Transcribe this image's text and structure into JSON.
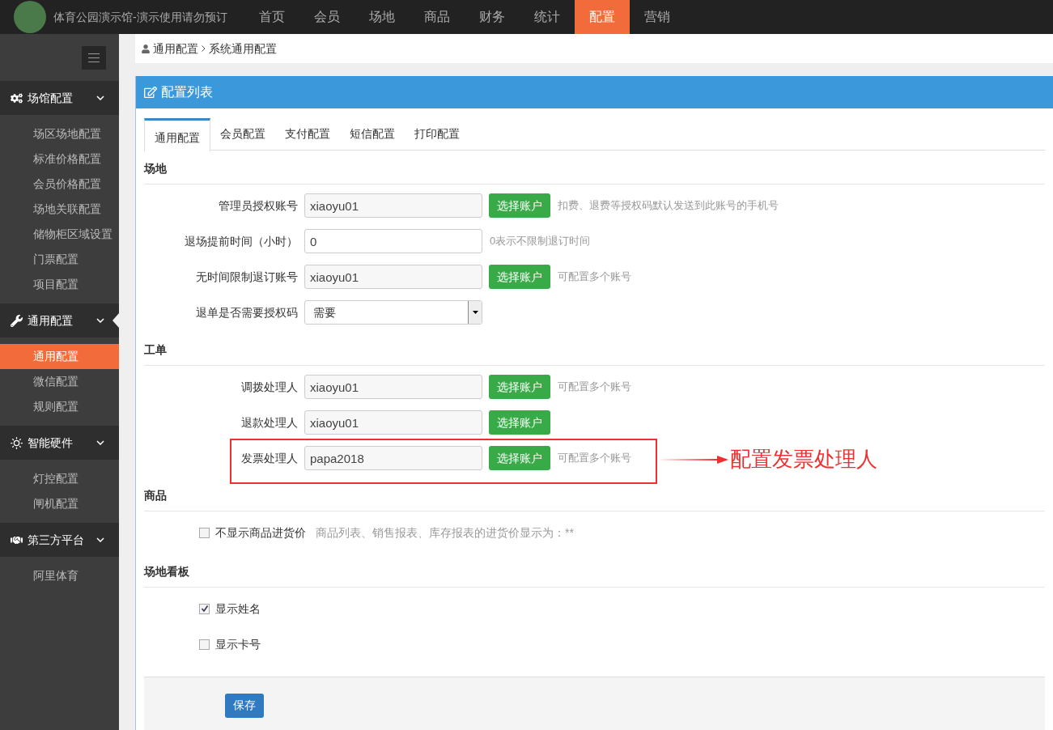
{
  "brand": {
    "title": "体育公园演示馆-演示使用请勿预订"
  },
  "nav": [
    {
      "label": "首页",
      "selected": false
    },
    {
      "label": "会员",
      "selected": false
    },
    {
      "label": "场地",
      "selected": false
    },
    {
      "label": "商品",
      "selected": false
    },
    {
      "label": "财务",
      "selected": false
    },
    {
      "label": "统计",
      "selected": false
    },
    {
      "label": "配置",
      "selected": true
    },
    {
      "label": "营销",
      "selected": false
    }
  ],
  "sidebar": {
    "groups": [
      {
        "label": "场馆配置",
        "expanded": true,
        "current": false,
        "items": [
          {
            "label": "场区场地配置",
            "selected": false
          },
          {
            "label": "标准价格配置",
            "selected": false
          },
          {
            "label": "会员价格配置",
            "selected": false
          },
          {
            "label": "场地关联配置",
            "selected": false
          },
          {
            "label": "储物柜区域设置",
            "selected": false
          },
          {
            "label": "门票配置",
            "selected": false
          },
          {
            "label": "项目配置",
            "selected": false
          }
        ]
      },
      {
        "label": "通用配置",
        "expanded": true,
        "current": true,
        "items": [
          {
            "label": "通用配置",
            "selected": true
          },
          {
            "label": "微信配置",
            "selected": false
          },
          {
            "label": "规则配置",
            "selected": false
          }
        ]
      },
      {
        "label": "智能硬件",
        "expanded": true,
        "current": false,
        "items": [
          {
            "label": "灯控配置",
            "selected": false
          },
          {
            "label": "闸机配置",
            "selected": false
          }
        ]
      },
      {
        "label": "第三方平台",
        "expanded": true,
        "current": false,
        "items": [
          {
            "label": "阿里体育",
            "selected": false
          }
        ]
      }
    ]
  },
  "breadcrumb": [
    "通用配置",
    "系统通用配置"
  ],
  "panel": {
    "title": "配置列表",
    "tabs": [
      {
        "label": "通用配置",
        "selected": true
      },
      {
        "label": "会员配置",
        "selected": false
      },
      {
        "label": "支付配置",
        "selected": false
      },
      {
        "label": "短信配置",
        "selected": false
      },
      {
        "label": "打印配置",
        "selected": false
      }
    ],
    "sections": [
      {
        "title": "场地",
        "rows": [
          {
            "kind": "account",
            "label": "管理员授权账号",
            "value": "xiaoyu01",
            "button": "选择账户",
            "hint": "扣费、退费等授权码默认发送到此账号的手机号",
            "highlighted": false
          },
          {
            "kind": "text",
            "label": "退场提前时间（小时）",
            "value": "0",
            "hint": "0表示不限制退订时间",
            "highlighted": false
          },
          {
            "kind": "account",
            "label": "无时间限制退订账号",
            "value": "xiaoyu01",
            "button": "选择账户",
            "hint": "可配置多个账号",
            "highlighted": false
          },
          {
            "kind": "select",
            "label": "退单是否需要授权码",
            "value": "需要",
            "highlighted": false
          }
        ]
      },
      {
        "title": "工单",
        "rows": [
          {
            "kind": "account",
            "label": "调拨处理人",
            "value": "xiaoyu01",
            "button": "选择账户",
            "hint": "可配置多个账号",
            "highlighted": false
          },
          {
            "kind": "account",
            "label": "退款处理人",
            "value": "xiaoyu01",
            "button": "选择账户",
            "highlighted": false
          },
          {
            "kind": "account",
            "label": "发票处理人",
            "value": "papa2018",
            "button": "选择账户",
            "hint": "可配置多个账号",
            "highlighted": true,
            "annotation": "配置发票处理人"
          }
        ]
      },
      {
        "title": "商品",
        "rows": [
          {
            "kind": "checkbox",
            "label": "不显示商品进货价",
            "checked": false,
            "hint": "商品列表、销售报表、库存报表的进货价显示为：**"
          }
        ]
      },
      {
        "title": "场地看板",
        "rows": [
          {
            "kind": "checkbox",
            "label": "显示姓名",
            "checked": true
          },
          {
            "kind": "checkbox",
            "label": "显示卡号",
            "checked": false
          }
        ]
      }
    ],
    "save": "保存"
  }
}
